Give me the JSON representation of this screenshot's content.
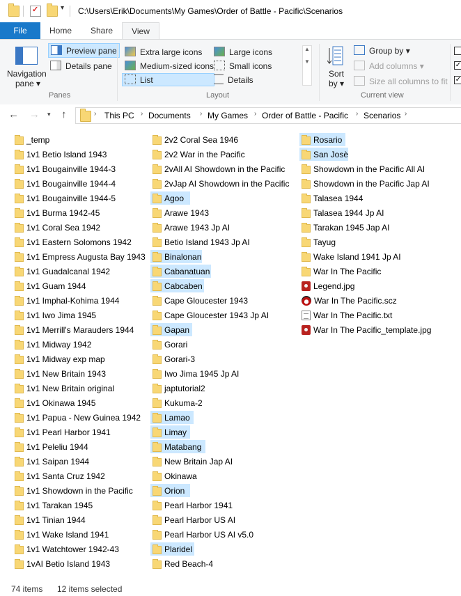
{
  "titlebar": {
    "path": "C:\\Users\\Erik\\Documents\\My Games\\Order of Battle - Pacific\\Scenarios"
  },
  "tabs": {
    "file": "File",
    "home": "Home",
    "share": "Share",
    "view": "View"
  },
  "ribbon": {
    "panes": {
      "navigation_pane": "Navigation",
      "navigation_pane2": "pane ▾",
      "preview_pane": "Preview pane",
      "details_pane": "Details pane",
      "label": "Panes"
    },
    "layout": {
      "extra_large": "Extra large icons",
      "large": "Large icons",
      "medium": "Medium-sized icons",
      "small": "Small icons",
      "list": "List",
      "details": "Details",
      "label": "Layout"
    },
    "current_view": {
      "sort_by": "Sort",
      "sort_by2": "by ▾",
      "group_by": "Group by ▾",
      "add_columns": "Add columns ▾",
      "size_columns": "Size all columns to fit",
      "label": "Current view"
    }
  },
  "breadcrumbs": [
    "This PC",
    "Documents",
    "My Games",
    "Order of Battle - Pacific",
    "Scenarios"
  ],
  "files": {
    "col1": [
      {
        "name": "_temp",
        "type": "folder",
        "selected": false
      },
      {
        "name": "1v1 Betio Island 1943",
        "type": "folder",
        "selected": false
      },
      {
        "name": "1v1 Bougainville 1944-3",
        "type": "folder",
        "selected": false
      },
      {
        "name": "1v1 Bougainville 1944-4",
        "type": "folder",
        "selected": false
      },
      {
        "name": "1v1 Bougainville 1944-5",
        "type": "folder",
        "selected": false
      },
      {
        "name": "1v1 Burma 1942-45",
        "type": "folder",
        "selected": false
      },
      {
        "name": "1v1 Coral Sea 1942",
        "type": "folder",
        "selected": false
      },
      {
        "name": "1v1 Eastern Solomons 1942",
        "type": "folder",
        "selected": false
      },
      {
        "name": "1v1 Empress Augusta Bay 1943",
        "type": "folder",
        "selected": false
      },
      {
        "name": "1v1 Guadalcanal 1942",
        "type": "folder",
        "selected": false
      },
      {
        "name": "1v1 Guam 1944",
        "type": "folder",
        "selected": false
      },
      {
        "name": "1v1 Imphal-Kohima 1944",
        "type": "folder",
        "selected": false
      },
      {
        "name": "1v1 Iwo Jima 1945",
        "type": "folder",
        "selected": false
      },
      {
        "name": "1v1 Merrill's Marauders 1944",
        "type": "folder",
        "selected": false
      },
      {
        "name": "1v1 Midway 1942",
        "type": "folder",
        "selected": false
      },
      {
        "name": "1v1 Midway exp map",
        "type": "folder",
        "selected": false
      },
      {
        "name": "1v1 New Britain 1943",
        "type": "folder",
        "selected": false
      },
      {
        "name": "1v1 New Britain original",
        "type": "folder",
        "selected": false
      },
      {
        "name": "1v1 Okinawa 1945",
        "type": "folder",
        "selected": false
      },
      {
        "name": "1v1 Papua - New Guinea 1942",
        "type": "folder",
        "selected": false
      },
      {
        "name": "1v1 Pearl Harbor 1941",
        "type": "folder",
        "selected": false
      },
      {
        "name": "1v1 Peleliu 1944",
        "type": "folder",
        "selected": false
      },
      {
        "name": "1v1 Saipan 1944",
        "type": "folder",
        "selected": false
      },
      {
        "name": "1v1 Santa Cruz 1942",
        "type": "folder",
        "selected": false
      },
      {
        "name": "1v1 Showdown in the Pacific",
        "type": "folder",
        "selected": false
      },
      {
        "name": "1v1 Tarakan 1945",
        "type": "folder",
        "selected": false
      },
      {
        "name": "1v1 Tinian 1944",
        "type": "folder",
        "selected": false
      },
      {
        "name": "1v1 Wake Island 1941",
        "type": "folder",
        "selected": false
      },
      {
        "name": "1v1 Watchtower 1942-43",
        "type": "folder",
        "selected": false
      },
      {
        "name": "1vAI Betio Island 1943",
        "type": "folder",
        "selected": false
      }
    ],
    "col2": [
      {
        "name": "2v2 Coral Sea 1946",
        "type": "folder",
        "selected": false
      },
      {
        "name": "2v2 War in the Pacific",
        "type": "folder",
        "selected": false
      },
      {
        "name": "2vAll AI Showdown in the Pacific",
        "type": "folder",
        "selected": false
      },
      {
        "name": "2vJap AI Showdown in the Pacific",
        "type": "folder",
        "selected": false
      },
      {
        "name": "Agoo",
        "type": "folder",
        "selected": true
      },
      {
        "name": "Arawe 1943",
        "type": "folder",
        "selected": false
      },
      {
        "name": "Arawe 1943 Jp AI",
        "type": "folder",
        "selected": false
      },
      {
        "name": "Betio Island 1943 Jp AI",
        "type": "folder",
        "selected": false
      },
      {
        "name": "Binalonan",
        "type": "folder",
        "selected": true
      },
      {
        "name": "Cabanatuan",
        "type": "folder",
        "selected": true
      },
      {
        "name": "Cabcaben",
        "type": "folder",
        "selected": true
      },
      {
        "name": "Cape Gloucester 1943",
        "type": "folder",
        "selected": false
      },
      {
        "name": "Cape Gloucester 1943 Jp AI",
        "type": "folder",
        "selected": false
      },
      {
        "name": "Gapan",
        "type": "folder",
        "selected": true
      },
      {
        "name": "Gorari",
        "type": "folder",
        "selected": false
      },
      {
        "name": "Gorari-3",
        "type": "folder",
        "selected": false
      },
      {
        "name": "Iwo Jima 1945 Jp AI",
        "type": "folder",
        "selected": false
      },
      {
        "name": "japtutorial2",
        "type": "folder",
        "selected": false
      },
      {
        "name": "Kukuma-2",
        "type": "folder",
        "selected": false
      },
      {
        "name": "Lamao",
        "type": "folder",
        "selected": true
      },
      {
        "name": "Limay",
        "type": "folder",
        "selected": true
      },
      {
        "name": "Matabang",
        "type": "folder",
        "selected": true
      },
      {
        "name": "New Britain Jap AI",
        "type": "folder",
        "selected": false
      },
      {
        "name": "Okinawa",
        "type": "folder",
        "selected": false
      },
      {
        "name": "Orion",
        "type": "folder",
        "selected": true
      },
      {
        "name": "Pearl Harbor 1941",
        "type": "folder",
        "selected": false
      },
      {
        "name": "Pearl Harbor US AI",
        "type": "folder",
        "selected": false
      },
      {
        "name": "Pearl Harbor US AI v5.0",
        "type": "folder",
        "selected": false
      },
      {
        "name": "Plaridel",
        "type": "folder",
        "selected": true
      },
      {
        "name": "Red Beach-4",
        "type": "folder",
        "selected": false
      }
    ],
    "col3": [
      {
        "name": "Rosario",
        "type": "folder",
        "selected": true
      },
      {
        "name": "San Josè",
        "type": "folder",
        "selected": true
      },
      {
        "name": "Showdown in the Pacific All AI",
        "type": "folder",
        "selected": false
      },
      {
        "name": "Showdown in the Pacific Jap AI",
        "type": "folder",
        "selected": false
      },
      {
        "name": "Talasea 1944",
        "type": "folder",
        "selected": false
      },
      {
        "name": "Talasea 1944 Jp AI",
        "type": "folder",
        "selected": false
      },
      {
        "name": "Tarakan 1945 Jap AI",
        "type": "folder",
        "selected": false
      },
      {
        "name": "Tayug",
        "type": "folder",
        "selected": false
      },
      {
        "name": "Wake Island 1941 Jp AI",
        "type": "folder",
        "selected": false
      },
      {
        "name": "War In The Pacific",
        "type": "folder",
        "selected": false
      },
      {
        "name": "Legend.jpg",
        "type": "jpg",
        "selected": false
      },
      {
        "name": "War In The Pacific.scz",
        "type": "scz",
        "selected": false
      },
      {
        "name": "War In The Pacific.txt",
        "type": "txt",
        "selected": false
      },
      {
        "name": "War In The Pacific_template.jpg",
        "type": "jpg",
        "selected": false
      }
    ]
  },
  "status": {
    "items": "74 items",
    "selected": "12 items selected"
  },
  "colors": {
    "accent": "#1979ca",
    "selection": "#cce8ff",
    "folder": "#f8d775"
  }
}
